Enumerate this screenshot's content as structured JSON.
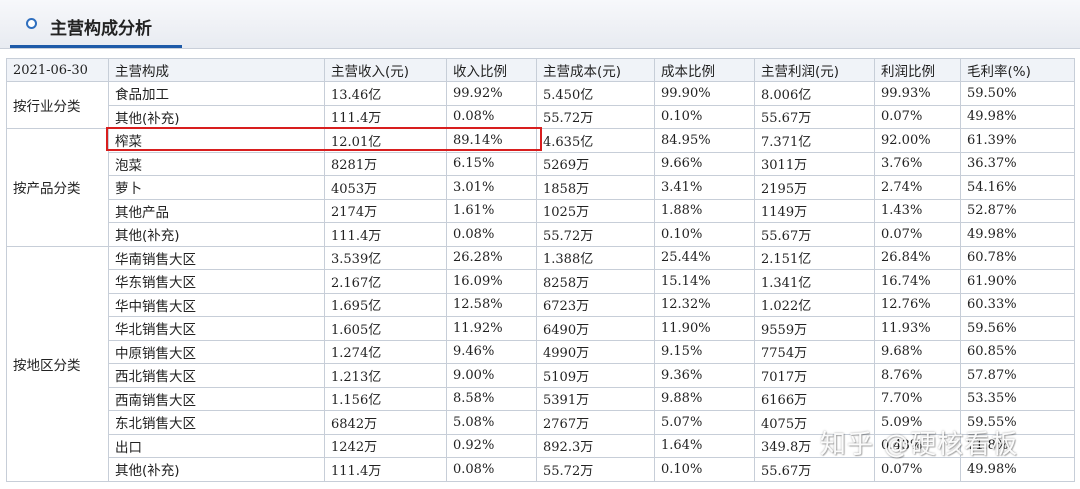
{
  "section_title": "主营构成分析",
  "table": {
    "headers": [
      "2021-06-30",
      "主营构成",
      "主营收入(元)",
      "收入比例",
      "主营成本(元)",
      "成本比例",
      "主营利润(元)",
      "利润比例",
      "毛利率(%)"
    ],
    "groups": [
      {
        "name": "按行业分类",
        "rows": [
          [
            "食品加工",
            "13.46亿",
            "99.92%",
            "5.450亿",
            "99.90%",
            "8.006亿",
            "99.93%",
            "59.50%"
          ],
          [
            "其他(补充)",
            "111.4万",
            "0.08%",
            "55.72万",
            "0.10%",
            "55.67万",
            "0.07%",
            "49.98%"
          ]
        ]
      },
      {
        "name": "按产品分类",
        "rows": [
          [
            "榨菜",
            "12.01亿",
            "89.14%",
            "4.635亿",
            "84.95%",
            "7.371亿",
            "92.00%",
            "61.39%"
          ],
          [
            "泡菜",
            "8281万",
            "6.15%",
            "5269万",
            "9.66%",
            "3011万",
            "3.76%",
            "36.37%"
          ],
          [
            "萝卜",
            "4053万",
            "3.01%",
            "1858万",
            "3.41%",
            "2195万",
            "2.74%",
            "54.16%"
          ],
          [
            "其他产品",
            "2174万",
            "1.61%",
            "1025万",
            "1.88%",
            "1149万",
            "1.43%",
            "52.87%"
          ],
          [
            "其他(补充)",
            "111.4万",
            "0.08%",
            "55.72万",
            "0.10%",
            "55.67万",
            "0.07%",
            "49.98%"
          ]
        ]
      },
      {
        "name": "按地区分类",
        "rows": [
          [
            "华南销售大区",
            "3.539亿",
            "26.28%",
            "1.388亿",
            "25.44%",
            "2.151亿",
            "26.84%",
            "60.78%"
          ],
          [
            "华东销售大区",
            "2.167亿",
            "16.09%",
            "8258万",
            "15.14%",
            "1.341亿",
            "16.74%",
            "61.90%"
          ],
          [
            "华中销售大区",
            "1.695亿",
            "12.58%",
            "6723万",
            "12.32%",
            "1.022亿",
            "12.76%",
            "60.33%"
          ],
          [
            "华北销售大区",
            "1.605亿",
            "11.92%",
            "6490万",
            "11.90%",
            "9559万",
            "11.93%",
            "59.56%"
          ],
          [
            "中原销售大区",
            "1.274亿",
            "9.46%",
            "4990万",
            "9.15%",
            "7754万",
            "9.68%",
            "60.85%"
          ],
          [
            "西北销售大区",
            "1.213亿",
            "9.00%",
            "5109万",
            "9.36%",
            "7017万",
            "8.76%",
            "57.87%"
          ],
          [
            "西南销售大区",
            "1.156亿",
            "8.58%",
            "5391万",
            "9.88%",
            "6166万",
            "7.70%",
            "53.35%"
          ],
          [
            "东北销售大区",
            "6842万",
            "5.08%",
            "2767万",
            "5.07%",
            "4075万",
            "5.09%",
            "59.55%"
          ],
          [
            "出口",
            "1242万",
            "0.92%",
            "892.3万",
            "1.64%",
            "349.8万",
            "0.43%",
            "71.8%"
          ],
          [
            "其他(补充)",
            "111.4万",
            "0.08%",
            "55.72万",
            "0.10%",
            "55.67万",
            "0.07%",
            "49.98%"
          ]
        ]
      }
    ]
  },
  "watermark": "知乎 @硬核看板",
  "colors": {
    "accent": "#1e5aa8",
    "highlight_border": "#d81e1e",
    "grid": "#c7ced8"
  }
}
